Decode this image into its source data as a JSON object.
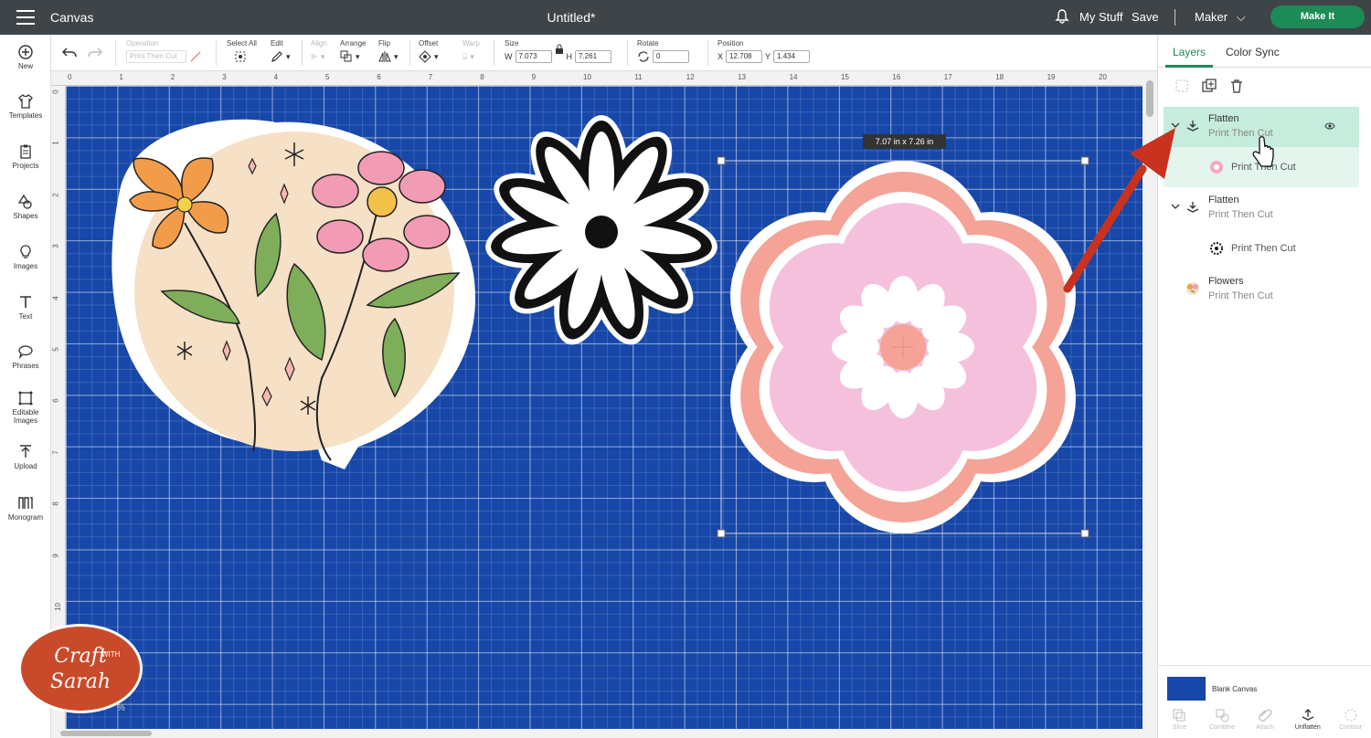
{
  "topbar": {
    "app_title": "Canvas",
    "doc_title": "Untitled*",
    "my_stuff": "My Stuff",
    "save": "Save",
    "machine": "Maker",
    "make_it": "Make It"
  },
  "toolbar": {
    "operation_label": "Operation",
    "operation_value": "Print Then Cut",
    "select_all": "Select All",
    "edit": "Edit",
    "align": "Align",
    "arrange": "Arrange",
    "flip": "Flip",
    "offset": "Offset",
    "warp": "Warp",
    "size": "Size",
    "w_label": "W",
    "w_value": "7.073",
    "h_label": "H",
    "h_value": "7.261",
    "rotate": "Rotate",
    "rotate_value": "0",
    "position": "Position",
    "x_label": "X",
    "x_value": "12.708",
    "y_label": "Y",
    "y_value": "1.434"
  },
  "leftnav": [
    {
      "label": "New",
      "icon": "plus-circle-icon"
    },
    {
      "label": "Templates",
      "icon": "shirt-icon"
    },
    {
      "label": "Projects",
      "icon": "clipboard-icon"
    },
    {
      "label": "Shapes",
      "icon": "shapes-icon"
    },
    {
      "label": "Images",
      "icon": "lightbulb-icon"
    },
    {
      "label": "Text",
      "icon": "text-t-icon"
    },
    {
      "label": "Phrases",
      "icon": "speech-bubble-icon"
    },
    {
      "label": "Editable Images",
      "icon": "editable-image-icon"
    },
    {
      "label": "Upload",
      "icon": "upload-icon"
    },
    {
      "label": "Monogram",
      "icon": "monogram-icon"
    }
  ],
  "ruler": {
    "top": [
      "0",
      "1",
      "2",
      "3",
      "4",
      "5",
      "6",
      "7",
      "8",
      "9",
      "10",
      "11",
      "12",
      "13",
      "14",
      "15",
      "16",
      "17",
      "18",
      "19",
      "20"
    ],
    "left": [
      "0",
      "1",
      "2",
      "3",
      "4",
      "5",
      "6",
      "7",
      "8",
      "9",
      "10"
    ]
  },
  "canvas": {
    "size_tooltip": "7.07  in x 7.26  in",
    "zoom_hint": "%"
  },
  "panel": {
    "tab_layers": "Layers",
    "tab_color_sync": "Color Sync",
    "layers": [
      {
        "name": "Flatten",
        "sub": "Print Then Cut",
        "selected": true
      },
      {
        "name": "Print Then Cut",
        "child": true
      },
      {
        "name": "Flatten",
        "sub": "Print Then Cut"
      },
      {
        "name": "Print Then Cut",
        "child": true
      },
      {
        "name": "Flowers",
        "sub": "Print Then Cut"
      }
    ],
    "blank_canvas": "Blank Canvas",
    "bottom_tools": [
      "Slice",
      "Combine",
      "Attach",
      "Unflatten",
      "Contour"
    ]
  },
  "watermark": {
    "line1": "Craft",
    "with": "WITH",
    "line2": "Sarah"
  },
  "colors": {
    "topbar": "#3f4448",
    "accent_green": "#1c8b55",
    "canvas_blue": "#1747a8",
    "arrow_red": "#c8321e",
    "flower_pink": "#f5c0dc",
    "flower_salmon": "#f4a396"
  }
}
